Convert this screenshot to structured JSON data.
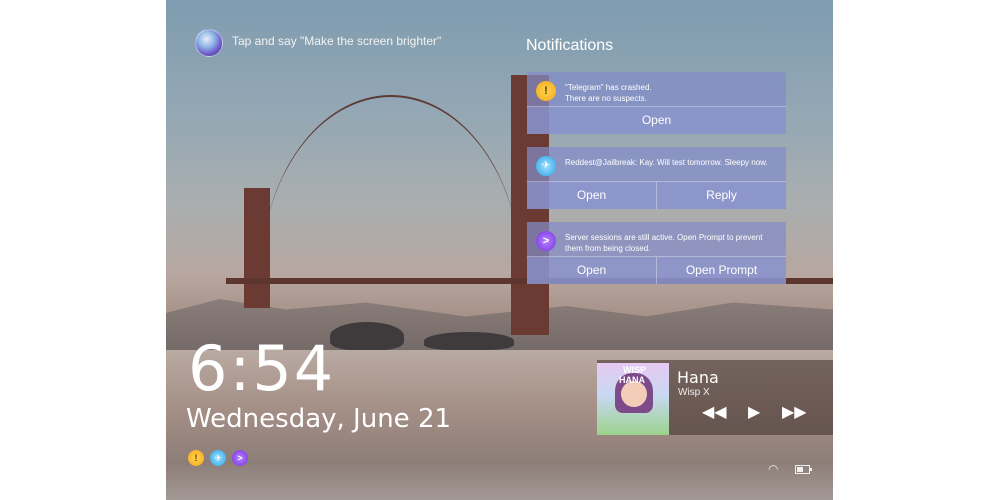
{
  "siri": {
    "prompt": "Tap and say \"Make the screen brighter\""
  },
  "notifications": {
    "title": "Notifications",
    "items": [
      {
        "icon": "warning-icon",
        "text": "\"Telegram\" has crashed.\nThere are no suspects.",
        "actions": [
          "Open"
        ]
      },
      {
        "icon": "telegram-icon",
        "text": "Reddest@Jailbreak: Kay. Will test tomorrow. Sleepy now.",
        "actions": [
          "Open",
          "Reply"
        ]
      },
      {
        "icon": "prompt-icon",
        "text": "Server sessions are still active. Open Prompt to prevent them from being closed.",
        "actions": [
          "Open",
          "Open Prompt"
        ]
      }
    ]
  },
  "lockscreen": {
    "time": "6:54",
    "date": "Wednesday, June 21"
  },
  "status_icons": [
    "warning-icon",
    "telegram-icon",
    "prompt-icon"
  ],
  "player": {
    "song": "Hana",
    "artist": "Wisp X",
    "album_art_text_1": "WISP",
    "album_art_text_2": "HANA",
    "controls": [
      "rewind-icon",
      "play-icon",
      "fast-forward-icon"
    ]
  },
  "system": {
    "wifi": "wifi-icon",
    "battery": "battery-icon"
  }
}
